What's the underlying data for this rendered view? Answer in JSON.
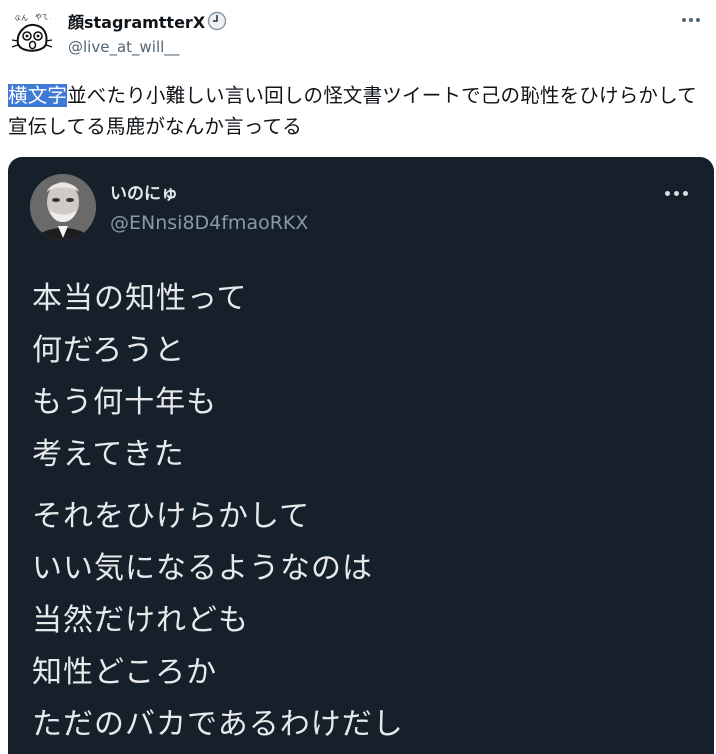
{
  "post": {
    "display_name": "顔stagramtterX",
    "handle": "@live_at_will__",
    "avatar_icon": "doodle-face-avatar-icon",
    "verified_icon": "clock-icon",
    "more_icon": "more-options-icon",
    "text_highlight": "横文字",
    "text_rest": "並べたり小難しい言い回しの怪文書ツイートで己の恥性をひけらかして宣伝してる馬鹿がなんか言ってる"
  },
  "quoted_post": {
    "display_name": "いのにゅ",
    "handle": "@ENnsi8D4fmaoRKX",
    "avatar_icon": "bearded-man-avatar-icon",
    "more_icon": "more-options-icon",
    "stanza1": {
      "lines": [
        "本当の知性って",
        "何だろうと",
        "もう何十年も",
        "考えてきた"
      ]
    },
    "stanza2": {
      "lines": [
        "それをひけらかして",
        "いい気になるようなのは",
        "当然だけれども",
        "知性どころか",
        "ただのバカであるわけだし"
      ]
    }
  },
  "colors": {
    "highlight": "#3f7ad7",
    "embed_background": "#15202b",
    "embed_text": "#e7e9ea",
    "embed_handle": "#8b98a5",
    "secondary_text": "#536471"
  }
}
